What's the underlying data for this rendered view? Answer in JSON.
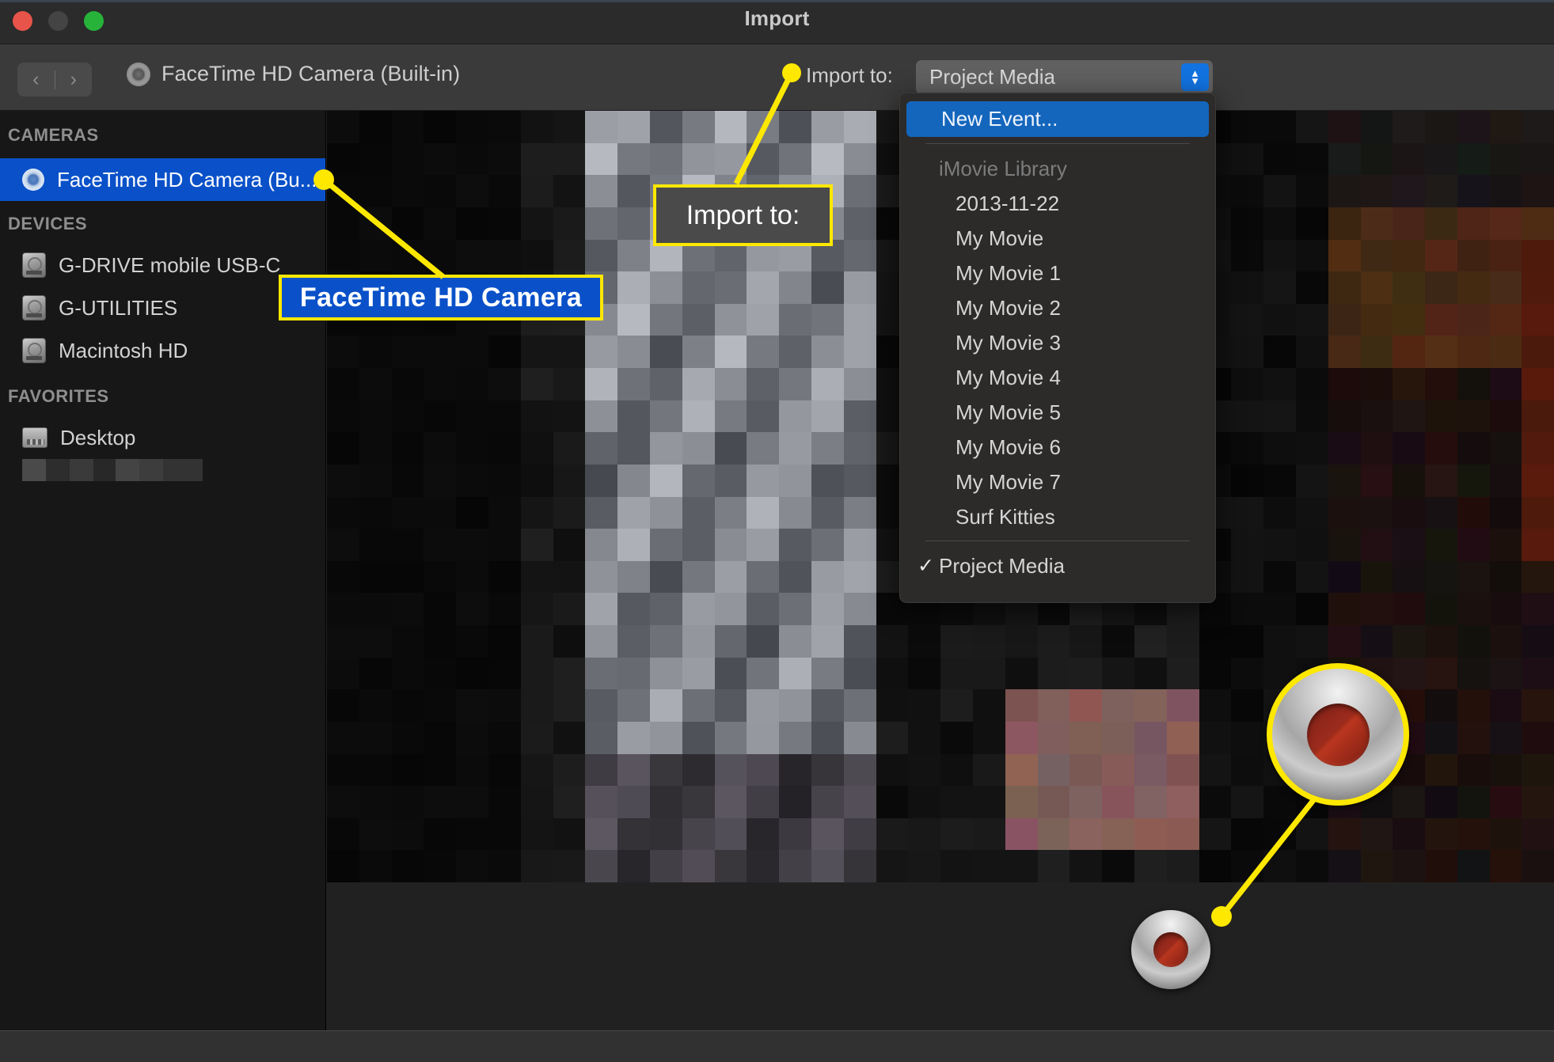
{
  "window": {
    "title": "Import",
    "traffic_lights": [
      "close-button",
      "minimize-button",
      "zoom-button"
    ]
  },
  "toolbar": {
    "back_glyph": "‹",
    "forward_glyph": "›",
    "camera_title": "FaceTime HD Camera (Built-in)",
    "import_to_label": "Import to:",
    "import_to_value": "Project Media",
    "chevron_up": "▴",
    "chevron_down": "▾"
  },
  "sidebar": {
    "sections": [
      {
        "header": "CAMERAS",
        "items": [
          {
            "label": "FaceTime HD Camera (Bu...",
            "icon": "camera-icon",
            "selected": true
          }
        ]
      },
      {
        "header": "DEVICES",
        "items": [
          {
            "label": "G-DRIVE mobile USB-C",
            "icon": "hard-drive-icon",
            "selected": false
          },
          {
            "label": "G-UTILITIES",
            "icon": "hard-drive-icon",
            "selected": false
          },
          {
            "label": "Macintosh HD",
            "icon": "hard-drive-icon",
            "selected": false
          }
        ]
      },
      {
        "header": "FAVORITES",
        "items": [
          {
            "label": "Desktop",
            "icon": "desktop-icon",
            "selected": false
          },
          {
            "label": "",
            "icon": "redacted-item",
            "selected": false
          }
        ]
      }
    ]
  },
  "dropdown_menu": {
    "highlighted": "New Event...",
    "group_header": "iMovie Library",
    "items": [
      "2013-11-22",
      "My Movie",
      "My Movie 1",
      "My Movie 2",
      "My Movie 3",
      "My Movie 4",
      "My Movie 5",
      "My Movie 6",
      "My Movie 7",
      "Surf Kitties"
    ],
    "checked_item": "Project Media",
    "check_glyph": "✓"
  },
  "callouts": [
    {
      "name": "facetime-camera-callout",
      "text": "FaceTime HD Camera",
      "bg": "#0a51c9",
      "border": "#ffe800"
    },
    {
      "name": "import-to-callout",
      "text": "Import to:",
      "bg": "#4a4a4a",
      "border": "#ffe800"
    }
  ],
  "record_buttons": {
    "record_button_label": "record-button",
    "magnified_label": "record-button-magnified"
  },
  "colors": {
    "accent_blue": "#0a51c9",
    "menu_highlight": "#1466bd",
    "annotation_yellow": "#ffe800",
    "record_red": "#9c2b1c",
    "titlebar": "#2b2b2b",
    "toolbar": "#3a3a3a",
    "sidebar": "#171717"
  }
}
